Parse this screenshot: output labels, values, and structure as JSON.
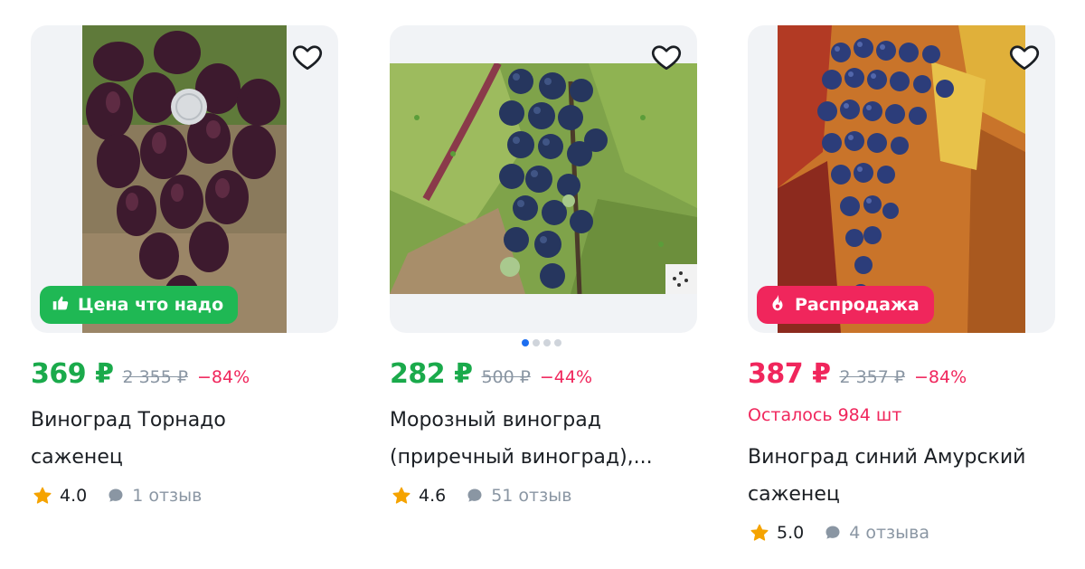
{
  "products": [
    {
      "price": "369 ₽",
      "old_price": "2 355 ₽",
      "discount": "−84%",
      "title_line1": "Виноград Торнадо",
      "title_line2": "саженец",
      "rating": "4.0",
      "reviews": "1 отзыв",
      "badge": "Цена что надо",
      "badge_icon": "thumbs-up-icon"
    },
    {
      "price": "282 ₽",
      "old_price": "500 ₽",
      "discount": "−44%",
      "title_line1": "Морозный виноград",
      "title_line2": "(приречный виноград),...",
      "rating": "4.6",
      "reviews": "51 отзыв",
      "image_dots": 4,
      "active_dot": 1
    },
    {
      "price": "387 ₽",
      "old_price": "2 357 ₽",
      "discount": "−84%",
      "stock": "Осталось 984 шт",
      "title_line1": "Виноград синий Амурский",
      "title_line2": "саженец",
      "rating": "5.0",
      "reviews": "4 отзыва",
      "badge": "Распродажа",
      "badge_icon": "fire-icon"
    }
  ],
  "colors": {
    "price_green": "#1aaa4b",
    "price_sale": "#f0265c",
    "badge_green": "#1fb854",
    "badge_pink": "#f0265c",
    "star": "#f5a300",
    "muted": "#8a96a3"
  }
}
